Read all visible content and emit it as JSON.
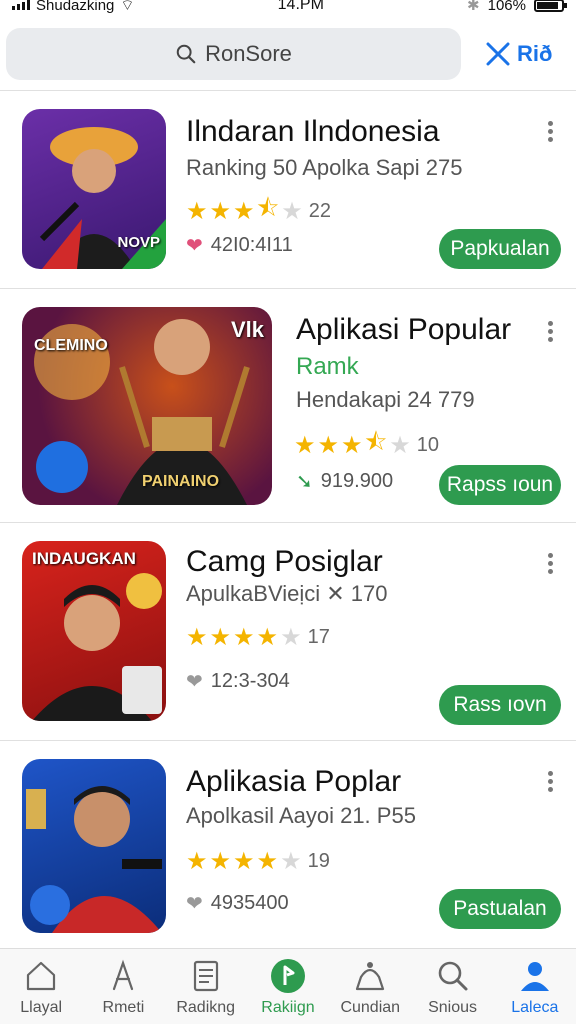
{
  "status": {
    "carrier": "Shudazking",
    "time": "14.PM",
    "battery": "106%"
  },
  "search": {
    "placeholder": "RonSore",
    "action_label": "Rið"
  },
  "apps": [
    {
      "title": "Ilndaran Ilndonesia",
      "subtitle": "Ranking 50 Apolka Sapi 275",
      "rank": "",
      "rating": 3.5,
      "rating_count": "22",
      "meta": "42I0:4I11",
      "meta_icon": "heart-icon",
      "button": "Papkualan",
      "icon_text": "NOVP"
    },
    {
      "title": "Aplikasi Popular",
      "subtitle": "Hendakapi 24 779",
      "rank": "Ramk",
      "rating": 3.5,
      "rating_count": "10",
      "meta": "919.900",
      "meta_icon": "download-icon",
      "button": "Rapss ıoun",
      "icon_text": "PAINAINO",
      "icon_text2": "CLEMINO",
      "icon_text3": "Vlk"
    },
    {
      "title": "Camg Posiglar",
      "subtitle": "ApulkaBVieịci ✕ 170",
      "rank": "",
      "rating": 4,
      "rating_count": "17",
      "meta": "12:3-304",
      "meta_icon": "heart-icon",
      "button": "Rass ıovn",
      "icon_text": "INDAUGKAN"
    },
    {
      "title": "Aplikasia Poplar",
      "subtitle": "Apolkasil Aayoi 21. P55",
      "rank": "",
      "rating": 4,
      "rating_count": "19",
      "meta": "4935400",
      "meta_icon": "heart-icon",
      "button": "Pastualan",
      "icon_text": ""
    }
  ],
  "nav": [
    {
      "label": "Llayal",
      "icon": "home-icon"
    },
    {
      "label": "Rmeti",
      "icon": "apps-icon"
    },
    {
      "label": "Radikng",
      "icon": "list-icon"
    },
    {
      "label": "Rakiign",
      "icon": "ranking-icon"
    },
    {
      "label": "Cundian",
      "icon": "category-icon"
    },
    {
      "label": "Snious",
      "icon": "search-icon"
    },
    {
      "label": "Laleca",
      "icon": "profile-icon"
    }
  ],
  "colors": {
    "accent": "#2e9b4f",
    "link": "#1a73e8",
    "star": "#f4b400"
  }
}
